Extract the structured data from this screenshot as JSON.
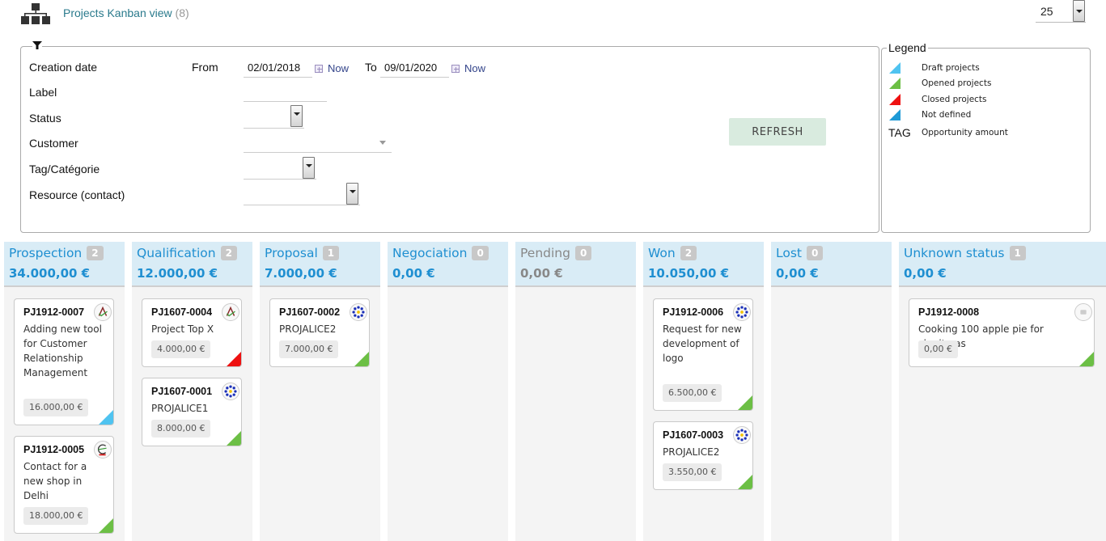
{
  "header": {
    "title": "Projects Kanban view",
    "count": "(8)",
    "page_size": "25"
  },
  "filters": {
    "creation_date_label": "Creation date",
    "from_label": "From",
    "from_value": "02/01/2018",
    "now_label": "Now",
    "to_label": "To",
    "to_value": "09/01/2020",
    "label_label": "Label",
    "label_value": "",
    "status_label": "Status",
    "customer_label": "Customer",
    "tag_label": "Tag/Catégorie",
    "resource_label": "Resource (contact)",
    "refresh_label": "REFRESH"
  },
  "legend": {
    "title": "Legend",
    "items": [
      {
        "label": "Draft projects",
        "color": "#4fc3f0"
      },
      {
        "label": "Opened projects",
        "color": "#6cbf45"
      },
      {
        "label": "Closed projects",
        "color": "#ee1111"
      },
      {
        "label": "Not defined",
        "color": "#1e9ad6"
      }
    ],
    "tag_symbol": "TAG",
    "tag_label": "Opportunity amount"
  },
  "colors": {
    "accent": "#1f8fd1",
    "header_bg": "#d9ecf6",
    "draft": "#4fc3f0",
    "opened": "#6cbf45",
    "closed": "#ee1111"
  },
  "columns": [
    {
      "name": "Prospection",
      "count": "2",
      "total": "34.000,00 €",
      "cards": [
        {
          "ref": "PJ1912-0007",
          "label": "Adding new tool for Customer Relationship Management",
          "amount": "16.000,00 €",
          "status": "draft",
          "logo": "customer-logo-a-icon"
        },
        {
          "ref": "PJ1912-0005",
          "label": "Contact for a new shop in Delhi",
          "amount": "18.000,00 €",
          "status": "opened",
          "logo": "customer-logo-e-icon"
        }
      ]
    },
    {
      "name": "Qualification",
      "count": "2",
      "total": "12.000,00 €",
      "cards": [
        {
          "ref": "PJ1607-0004",
          "label": "Project Top X",
          "amount": "4.000,00 €",
          "status": "closed",
          "logo": "customer-logo-a-icon"
        },
        {
          "ref": "PJ1607-0001",
          "label": "PROJALICE1",
          "amount": "8.000,00 €",
          "status": "opened",
          "logo": "customer-logo-stars-icon"
        }
      ]
    },
    {
      "name": "Proposal",
      "count": "1",
      "total": "7.000,00 €",
      "cards": [
        {
          "ref": "PJ1607-0002",
          "label": "PROJALICE2",
          "amount": "7.000,00 €",
          "status": "opened",
          "logo": "customer-logo-stars-icon"
        }
      ]
    },
    {
      "name": "Negociation",
      "count": "0",
      "total": "0,00 €",
      "cards": []
    },
    {
      "name": "Pending",
      "count": "0",
      "total": "0,00 €",
      "cards": []
    },
    {
      "name": "Won",
      "count": "2",
      "total": "10.050,00 €",
      "cards": [
        {
          "ref": "PJ1912-0006",
          "label": "Request for new development of logo",
          "amount": "6.500,00 €",
          "status": "opened",
          "logo": "customer-logo-stars-icon"
        },
        {
          "ref": "PJ1607-0003",
          "label": "PROJALICE2",
          "amount": "3.550,00 €",
          "status": "opened",
          "logo": "customer-logo-stars-icon"
        }
      ]
    },
    {
      "name": "Lost",
      "count": "0",
      "total": "0,00 €",
      "cards": []
    },
    {
      "name": "Unknown status",
      "count": "1",
      "total": "0,00 €",
      "cards": [
        {
          "ref": "PJ1912-0008",
          "label": "Cooking 100 apple pie for chrsitmas",
          "amount": "0,00 €",
          "status": "opened",
          "logo": "customer-logo-placeholder-icon"
        }
      ]
    }
  ]
}
